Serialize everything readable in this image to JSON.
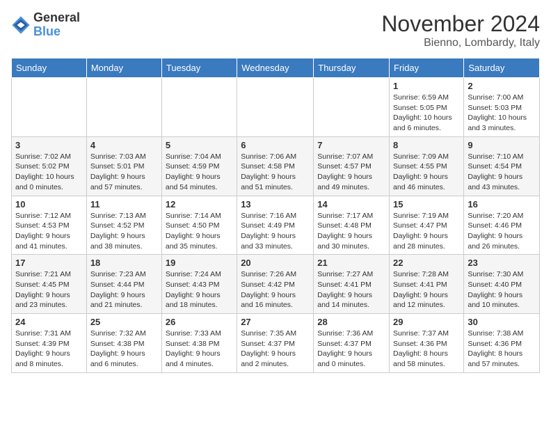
{
  "header": {
    "logo_general": "General",
    "logo_blue": "Blue",
    "month_title": "November 2024",
    "location": "Bienno, Lombardy, Italy"
  },
  "columns": [
    "Sunday",
    "Monday",
    "Tuesday",
    "Wednesday",
    "Thursday",
    "Friday",
    "Saturday"
  ],
  "weeks": [
    [
      {
        "day": "",
        "info": ""
      },
      {
        "day": "",
        "info": ""
      },
      {
        "day": "",
        "info": ""
      },
      {
        "day": "",
        "info": ""
      },
      {
        "day": "",
        "info": ""
      },
      {
        "day": "1",
        "info": "Sunrise: 6:59 AM\nSunset: 5:05 PM\nDaylight: 10 hours and 6 minutes."
      },
      {
        "day": "2",
        "info": "Sunrise: 7:00 AM\nSunset: 5:03 PM\nDaylight: 10 hours and 3 minutes."
      }
    ],
    [
      {
        "day": "3",
        "info": "Sunrise: 7:02 AM\nSunset: 5:02 PM\nDaylight: 10 hours and 0 minutes."
      },
      {
        "day": "4",
        "info": "Sunrise: 7:03 AM\nSunset: 5:01 PM\nDaylight: 9 hours and 57 minutes."
      },
      {
        "day": "5",
        "info": "Sunrise: 7:04 AM\nSunset: 4:59 PM\nDaylight: 9 hours and 54 minutes."
      },
      {
        "day": "6",
        "info": "Sunrise: 7:06 AM\nSunset: 4:58 PM\nDaylight: 9 hours and 51 minutes."
      },
      {
        "day": "7",
        "info": "Sunrise: 7:07 AM\nSunset: 4:57 PM\nDaylight: 9 hours and 49 minutes."
      },
      {
        "day": "8",
        "info": "Sunrise: 7:09 AM\nSunset: 4:55 PM\nDaylight: 9 hours and 46 minutes."
      },
      {
        "day": "9",
        "info": "Sunrise: 7:10 AM\nSunset: 4:54 PM\nDaylight: 9 hours and 43 minutes."
      }
    ],
    [
      {
        "day": "10",
        "info": "Sunrise: 7:12 AM\nSunset: 4:53 PM\nDaylight: 9 hours and 41 minutes."
      },
      {
        "day": "11",
        "info": "Sunrise: 7:13 AM\nSunset: 4:52 PM\nDaylight: 9 hours and 38 minutes."
      },
      {
        "day": "12",
        "info": "Sunrise: 7:14 AM\nSunset: 4:50 PM\nDaylight: 9 hours and 35 minutes."
      },
      {
        "day": "13",
        "info": "Sunrise: 7:16 AM\nSunset: 4:49 PM\nDaylight: 9 hours and 33 minutes."
      },
      {
        "day": "14",
        "info": "Sunrise: 7:17 AM\nSunset: 4:48 PM\nDaylight: 9 hours and 30 minutes."
      },
      {
        "day": "15",
        "info": "Sunrise: 7:19 AM\nSunset: 4:47 PM\nDaylight: 9 hours and 28 minutes."
      },
      {
        "day": "16",
        "info": "Sunrise: 7:20 AM\nSunset: 4:46 PM\nDaylight: 9 hours and 26 minutes."
      }
    ],
    [
      {
        "day": "17",
        "info": "Sunrise: 7:21 AM\nSunset: 4:45 PM\nDaylight: 9 hours and 23 minutes."
      },
      {
        "day": "18",
        "info": "Sunrise: 7:23 AM\nSunset: 4:44 PM\nDaylight: 9 hours and 21 minutes."
      },
      {
        "day": "19",
        "info": "Sunrise: 7:24 AM\nSunset: 4:43 PM\nDaylight: 9 hours and 18 minutes."
      },
      {
        "day": "20",
        "info": "Sunrise: 7:26 AM\nSunset: 4:42 PM\nDaylight: 9 hours and 16 minutes."
      },
      {
        "day": "21",
        "info": "Sunrise: 7:27 AM\nSunset: 4:41 PM\nDaylight: 9 hours and 14 minutes."
      },
      {
        "day": "22",
        "info": "Sunrise: 7:28 AM\nSunset: 4:41 PM\nDaylight: 9 hours and 12 minutes."
      },
      {
        "day": "23",
        "info": "Sunrise: 7:30 AM\nSunset: 4:40 PM\nDaylight: 9 hours and 10 minutes."
      }
    ],
    [
      {
        "day": "24",
        "info": "Sunrise: 7:31 AM\nSunset: 4:39 PM\nDaylight: 9 hours and 8 minutes."
      },
      {
        "day": "25",
        "info": "Sunrise: 7:32 AM\nSunset: 4:38 PM\nDaylight: 9 hours and 6 minutes."
      },
      {
        "day": "26",
        "info": "Sunrise: 7:33 AM\nSunset: 4:38 PM\nDaylight: 9 hours and 4 minutes."
      },
      {
        "day": "27",
        "info": "Sunrise: 7:35 AM\nSunset: 4:37 PM\nDaylight: 9 hours and 2 minutes."
      },
      {
        "day": "28",
        "info": "Sunrise: 7:36 AM\nSunset: 4:37 PM\nDaylight: 9 hours and 0 minutes."
      },
      {
        "day": "29",
        "info": "Sunrise: 7:37 AM\nSunset: 4:36 PM\nDaylight: 8 hours and 58 minutes."
      },
      {
        "day": "30",
        "info": "Sunrise: 7:38 AM\nSunset: 4:36 PM\nDaylight: 8 hours and 57 minutes."
      }
    ]
  ]
}
